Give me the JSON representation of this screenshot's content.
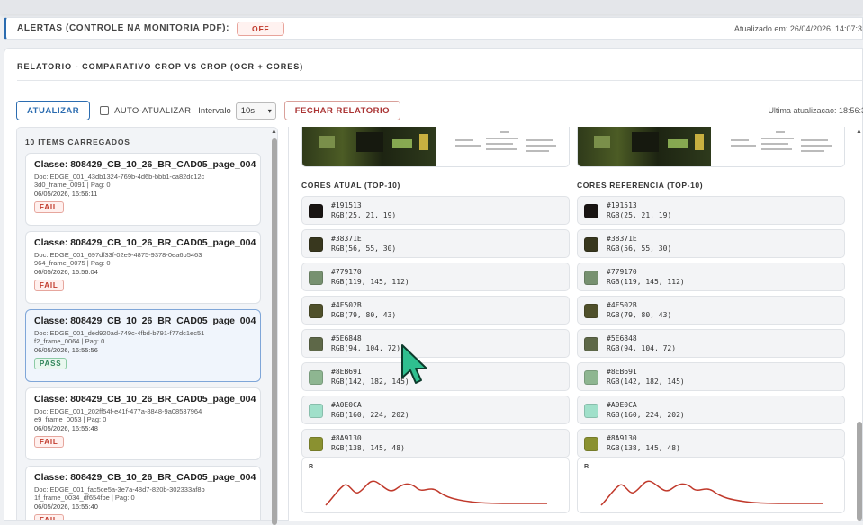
{
  "alert_bar": {
    "title": "ALERTAS (CONTROLE NA MONITORIA PDF):",
    "status": "OFF",
    "updated": "Atualizado em: 26/04/2026, 14:07:3"
  },
  "report": {
    "title": "RELATORIO - COMPARATIVO CROP VS CROP (OCR + CORES)"
  },
  "toolbar": {
    "update_label": "ATUALIZAR",
    "auto_update_label": "AUTO-ATUALIZAR",
    "auto_update_checked": false,
    "interval_label": "Intervalo",
    "interval_value": "10s",
    "close_label": "FECHAR RELATORIO",
    "last_update": "Ultima atualizacao: 18:56:3"
  },
  "list": {
    "title": "10 ITEMS CARREGADOS",
    "items": [
      {
        "title": "Classe: 808429_CB_10_26_BR_CAD05_page_004",
        "doc": "Doc: EDGE_001_43db1324-769b-4d6b-bbb1-ca82dc12c3d0_frame_0091 | Pag: 0",
        "time": "06/05/2026, 16:56:11",
        "status": "FAIL"
      },
      {
        "title": "Classe: 808429_CB_10_26_BR_CAD05_page_004",
        "doc": "Doc: EDGE_001_697df33f-02e9-4875-9378-0ea6b5463964_frame_0075 | Pag: 0",
        "time": "06/05/2026, 16:56:04",
        "status": "FAIL"
      },
      {
        "title": "Classe: 808429_CB_10_26_BR_CAD05_page_004",
        "doc": "Doc: EDGE_001_ded920ad-749c-4fbd-b791-f77dc1ec51f2_frame_0064 | Pag: 0",
        "time": "06/05/2026, 16:55:56",
        "status": "PASS"
      },
      {
        "title": "Classe: 808429_CB_10_26_BR_CAD05_page_004",
        "doc": "Doc: EDGE_001_202ff54f-e41f-477a-8848-9a08537964e9_frame_0053 | Pag: 0",
        "time": "06/05/2026, 16:55:48",
        "status": "FAIL"
      },
      {
        "title": "Classe: 808429_CB_10_26_BR_CAD05_page_004",
        "doc": "Doc: EDGE_001_fac5ce5a-3e7a-48d7-820b-302333af8b1f_frame_0034_df654fbe | Pag: 0",
        "time": "06/05/2026, 16:55:40",
        "status": "FAIL"
      }
    ]
  },
  "colors": {
    "current_title": "CORES ATUAL (TOP-10)",
    "reference_title": "CORES REFERENCIA (TOP-10)",
    "items": [
      {
        "hex": "#191513",
        "rgb": "RGB(25, 21, 19)"
      },
      {
        "hex": "#38371E",
        "rgb": "RGB(56, 55, 30)"
      },
      {
        "hex": "#779170",
        "rgb": "RGB(119, 145, 112)"
      },
      {
        "hex": "#4F502B",
        "rgb": "RGB(79, 80, 43)"
      },
      {
        "hex": "#5E6848",
        "rgb": "RGB(94, 104, 72)"
      },
      {
        "hex": "#8EB691",
        "rgb": "RGB(142, 182, 145)"
      },
      {
        "hex": "#A0E0CA",
        "rgb": "RGB(160, 224, 202)"
      },
      {
        "hex": "#8A9130",
        "rgb": "RGB(138, 145, 48)"
      }
    ]
  },
  "histogram": {
    "label": "R",
    "line_color": "#c0392b"
  },
  "theme": {
    "accent": "#2b6cb0",
    "fail": "#c0392b",
    "pass": "#2f855a"
  }
}
